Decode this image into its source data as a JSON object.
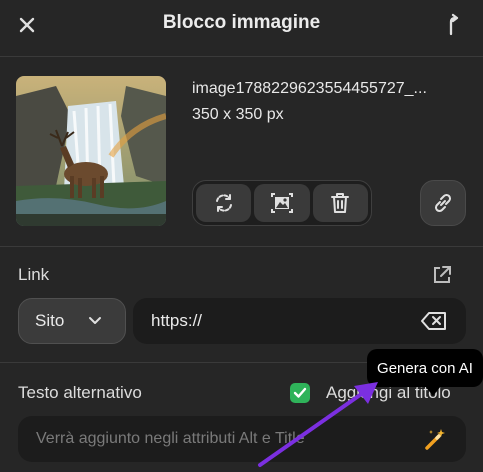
{
  "header": {
    "title": "Blocco immagine",
    "close_icon": "close-icon",
    "upload_icon": "upload-arrow-icon"
  },
  "image": {
    "filename": "image178822962355445572­7_...",
    "dimensions": "350 x 350 px"
  },
  "tools": {
    "replace_icon": "refresh-icon",
    "focal_icon": "focal-point-icon",
    "delete_icon": "trash-icon",
    "link_icon": "link-icon"
  },
  "link": {
    "label": "Link",
    "external_icon": "external-link-icon",
    "select_value": "Sito",
    "url_value": "https://",
    "clear_icon": "backspace-icon"
  },
  "alt": {
    "label": "Testo alternativo",
    "checkbox_label": "Aggiungi al titolo",
    "placeholder": "Verrà aggiunto negli attributi Alt e Title",
    "ai_icon": "magic-wand-icon",
    "tooltip": "Genera con AI"
  },
  "colors": {
    "background": "#262626",
    "accent_green": "#2fb35a",
    "annotation_arrow": "#7b2fe0"
  }
}
